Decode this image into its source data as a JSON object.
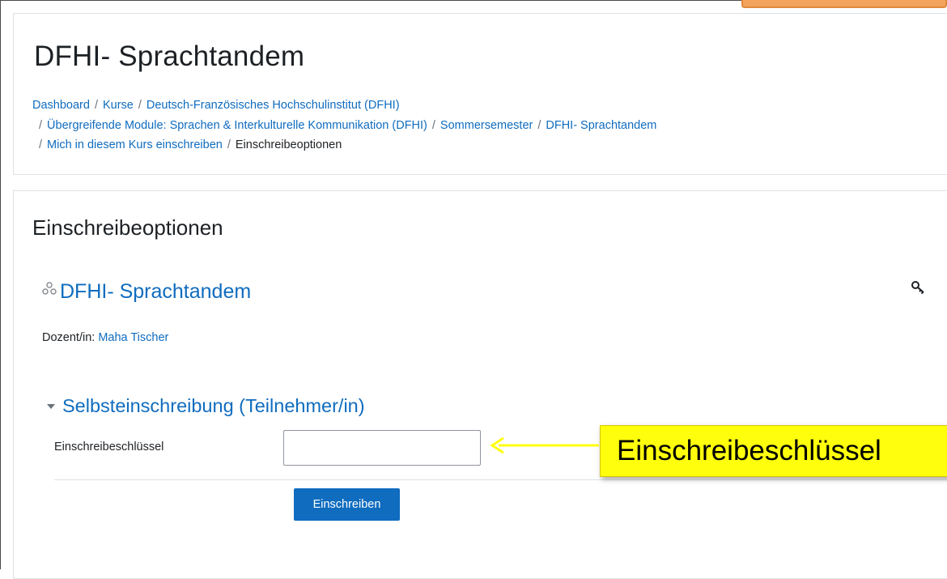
{
  "page": {
    "title": "DFHI- Sprachtandem"
  },
  "breadcrumb": {
    "dashboard": "Dashboard",
    "kurse": "Kurse",
    "dfhi": "Deutsch-Französisches Hochschulinstitut (DFHI)",
    "module": "Übergreifende Module: Sprachen & Interkulturelle Kommunikation (DFHI)",
    "semester": "Sommersemester",
    "course": "DFHI- Sprachtandem",
    "enrol_self": "Mich in diesem Kurs einschreiben",
    "current": "Einschreibeoptionen",
    "separator": "/"
  },
  "main": {
    "heading": "Einschreibeoptionen",
    "course_name": "DFHI- Sprachtandem",
    "teacher_label": "Dozent/in:",
    "teacher_name": "Maha Tischer"
  },
  "self_enrolment": {
    "title": "Selbsteinschreibung (Teilnehmer/in)",
    "key_label": "Einschreibeschlüssel",
    "key_value": "",
    "button_label": "Einschreiben"
  },
  "annotation": {
    "callout_text": "Einschreibeschlüssel",
    "callout_color": "#ffff0d",
    "arrow_color": "#ffff0d"
  },
  "colors": {
    "link": "#0f6cbf",
    "button": "#0f6cbf",
    "tab": "#f3a45c"
  }
}
